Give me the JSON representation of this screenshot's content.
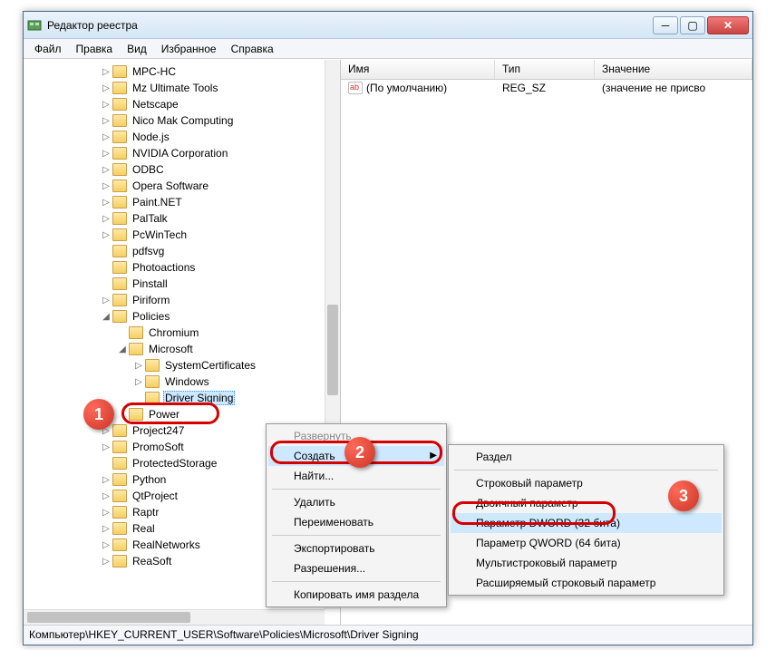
{
  "window": {
    "title": "Редактор реестра"
  },
  "menubar": [
    "Файл",
    "Правка",
    "Вид",
    "Избранное",
    "Справка"
  ],
  "tree": {
    "items": [
      {
        "depth": 3,
        "label": "MPC-HC",
        "exp": "▷"
      },
      {
        "depth": 3,
        "label": "Mz Ultimate Tools",
        "exp": "▷"
      },
      {
        "depth": 3,
        "label": "Netscape",
        "exp": "▷"
      },
      {
        "depth": 3,
        "label": "Nico Mak Computing",
        "exp": "▷"
      },
      {
        "depth": 3,
        "label": "Node.js",
        "exp": "▷"
      },
      {
        "depth": 3,
        "label": "NVIDIA Corporation",
        "exp": "▷"
      },
      {
        "depth": 3,
        "label": "ODBC",
        "exp": "▷"
      },
      {
        "depth": 3,
        "label": "Opera Software",
        "exp": "▷"
      },
      {
        "depth": 3,
        "label": "Paint.NET",
        "exp": "▷"
      },
      {
        "depth": 3,
        "label": "PalTalk",
        "exp": "▷"
      },
      {
        "depth": 3,
        "label": "PcWinTech",
        "exp": "▷"
      },
      {
        "depth": 3,
        "label": "pdfsvg",
        "exp": ""
      },
      {
        "depth": 3,
        "label": "Photoactions",
        "exp": ""
      },
      {
        "depth": 3,
        "label": "Pinstall",
        "exp": ""
      },
      {
        "depth": 3,
        "label": "Piriform",
        "exp": "▷"
      },
      {
        "depth": 3,
        "label": "Policies",
        "exp": "◢"
      },
      {
        "depth": 4,
        "label": "Chromium",
        "exp": ""
      },
      {
        "depth": 4,
        "label": "Microsoft",
        "exp": "◢"
      },
      {
        "depth": 5,
        "label": "SystemCertificates",
        "exp": "▷"
      },
      {
        "depth": 5,
        "label": "Windows",
        "exp": "▷"
      },
      {
        "depth": 5,
        "label": "Driver Signing",
        "exp": "",
        "sel": true
      },
      {
        "depth": 4,
        "label": "Power",
        "exp": ""
      },
      {
        "depth": 3,
        "label": "Project247",
        "exp": "▷"
      },
      {
        "depth": 3,
        "label": "PromoSoft",
        "exp": "▷"
      },
      {
        "depth": 3,
        "label": "ProtectedStorage",
        "exp": ""
      },
      {
        "depth": 3,
        "label": "Python",
        "exp": "▷"
      },
      {
        "depth": 3,
        "label": "QtProject",
        "exp": "▷"
      },
      {
        "depth": 3,
        "label": "Raptr",
        "exp": "▷"
      },
      {
        "depth": 3,
        "label": "Real",
        "exp": "▷"
      },
      {
        "depth": 3,
        "label": "RealNetworks",
        "exp": "▷"
      },
      {
        "depth": 3,
        "label": "ReaSoft",
        "exp": "▷"
      }
    ]
  },
  "list": {
    "headers": [
      "Имя",
      "Тип",
      "Значение"
    ],
    "rows": [
      {
        "name": "(По умолчанию)",
        "type": "REG_SZ",
        "value": "(значение не присво"
      }
    ]
  },
  "ctx1": {
    "items": [
      {
        "label": "Развернуть",
        "disabled": true
      },
      {
        "label": "Создать",
        "submenu": true,
        "hover": true
      },
      {
        "label": "Найти..."
      },
      {
        "sep": true
      },
      {
        "label": "Удалить"
      },
      {
        "label": "Переименовать"
      },
      {
        "sep": true
      },
      {
        "label": "Экспортировать"
      },
      {
        "label": "Разрешения..."
      },
      {
        "sep": true
      },
      {
        "label": "Копировать имя раздела"
      }
    ]
  },
  "ctx2": {
    "items": [
      {
        "label": "Раздел"
      },
      {
        "sep": true
      },
      {
        "label": "Строковый параметр"
      },
      {
        "label": "Двоичный параметр"
      },
      {
        "label": "Параметр DWORD (32 бита)",
        "hover": true
      },
      {
        "label": "Параметр QWORD (64 бита)"
      },
      {
        "label": "Мультистроковый параметр"
      },
      {
        "label": "Расширяемый строковый параметр"
      }
    ]
  },
  "statusbar": "Компьютер\\HKEY_CURRENT_USER\\Software\\Policies\\Microsoft\\Driver Signing",
  "markers": {
    "m1": "1",
    "m2": "2",
    "m3": "3"
  }
}
